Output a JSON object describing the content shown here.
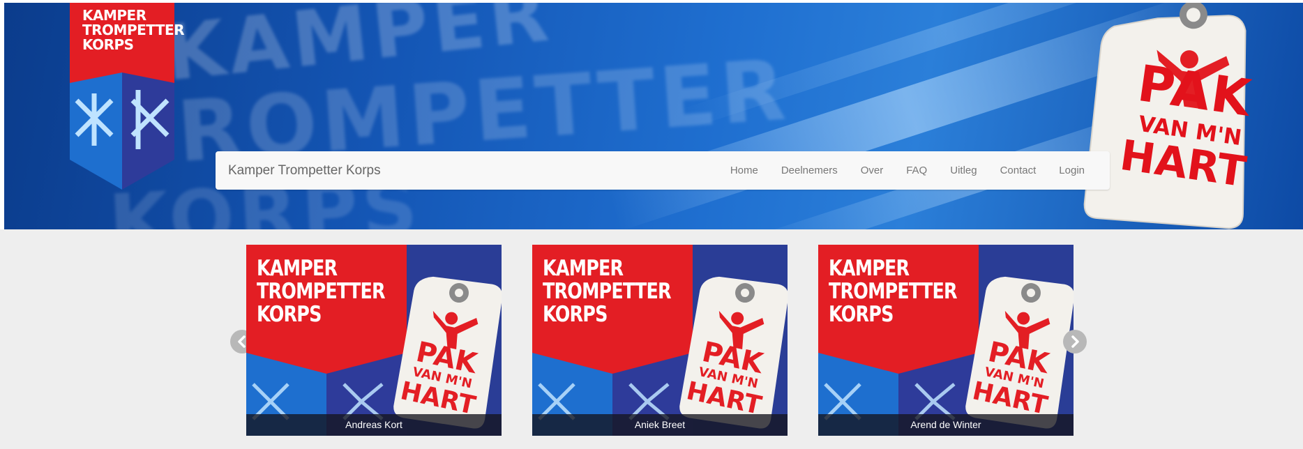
{
  "header": {
    "logo_lines": [
      "KAMPER",
      "TROMPETTER",
      "KORPS"
    ],
    "background_words": [
      "KAMPER",
      "TROMPETTER",
      "KORPS"
    ],
    "tag_lines": [
      "PAK",
      "VAN M'N",
      "HART"
    ]
  },
  "navbar": {
    "brand": "Kamper Trompetter Korps",
    "items": [
      {
        "label": "Home"
      },
      {
        "label": "Deelnemers"
      },
      {
        "label": "Over"
      },
      {
        "label": "FAQ"
      },
      {
        "label": "Uitleg"
      },
      {
        "label": "Contact"
      },
      {
        "label": "Login"
      }
    ]
  },
  "carousel": {
    "cards": [
      {
        "title_lines": [
          "KAMPER",
          "TROMPETTER",
          "KORPS"
        ],
        "tag_lines": [
          "PAK",
          "VAN M'N",
          "HART"
        ],
        "caption": "Andreas Kort"
      },
      {
        "title_lines": [
          "KAMPER",
          "TROMPETTER",
          "KORPS"
        ],
        "tag_lines": [
          "PAK",
          "VAN M'N",
          "HART"
        ],
        "caption": "Aniek Breet"
      },
      {
        "title_lines": [
          "KAMPER",
          "TROMPETTER",
          "KORPS"
        ],
        "tag_lines": [
          "PAK",
          "VAN M'N",
          "HART"
        ],
        "caption": "Arend de Winter"
      }
    ],
    "prev_icon": "chevron-left-icon",
    "next_icon": "chevron-right-icon"
  },
  "colors": {
    "brand_red": "#e31e24",
    "brand_blue": "#1456b5",
    "navbar_bg": "#f8f8f8",
    "page_bg": "#eeeeee"
  }
}
